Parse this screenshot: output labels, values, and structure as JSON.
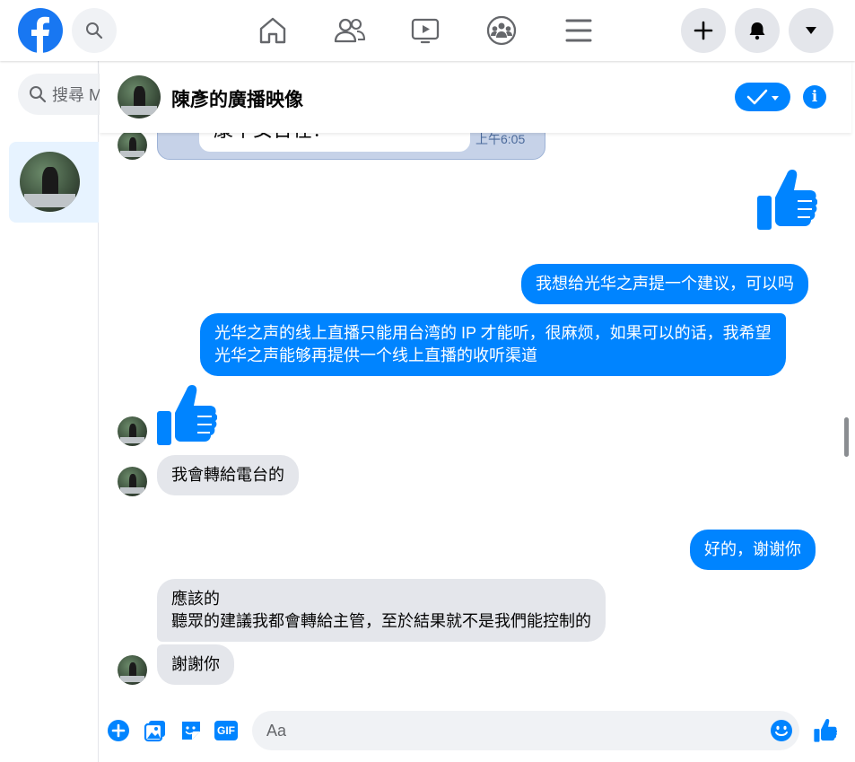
{
  "nav": {
    "search_placeholder": "搜尋 M"
  },
  "chat": {
    "title": "陳彥的廣播映像",
    "partial_message_text": "康中女台在？",
    "partial_message_time": "上午6:05"
  },
  "messages": [
    {
      "id": "m1",
      "direction": "outgoing",
      "type": "like"
    },
    {
      "id": "m2",
      "direction": "outgoing",
      "type": "text",
      "text": "我想给光华之声提一个建议，可以吗"
    },
    {
      "id": "m3",
      "direction": "outgoing",
      "type": "text",
      "line1": "光华之声的线上直播只能用台湾的 IP 才能听，很麻烦，如果可以的话，我希望",
      "line2": "光华之声能够再提供一个线上直播的收听渠道"
    },
    {
      "id": "m4",
      "direction": "incoming",
      "type": "like"
    },
    {
      "id": "m5",
      "direction": "incoming",
      "type": "text",
      "text": "我會轉給電台的"
    },
    {
      "id": "m6",
      "direction": "outgoing",
      "type": "text",
      "text": "好的，谢谢你"
    },
    {
      "id": "m7",
      "direction": "incoming",
      "type": "text",
      "line1": "應該的",
      "line2": "聽眾的建議我都會轉給主管，至於結果就不是我們能控制的"
    },
    {
      "id": "m8",
      "direction": "incoming",
      "type": "text",
      "text": "謝謝你"
    }
  ],
  "composer": {
    "placeholder": "Aa",
    "gif_label": "GIF"
  },
  "colors": {
    "brand": "#1877f2",
    "messenger_blue": "#0084ff",
    "incoming_bubble": "#e4e6eb"
  },
  "icons": [
    "facebook-logo",
    "search-icon",
    "home-icon",
    "friends-icon",
    "watch-icon",
    "groups-icon",
    "menu-icon",
    "plus-icon",
    "messenger-icon",
    "caret-down-icon",
    "check-icon",
    "info-icon",
    "like-icon",
    "add-circle-icon",
    "photo-icon",
    "sticker-icon",
    "gif-icon",
    "emoji-icon"
  ]
}
